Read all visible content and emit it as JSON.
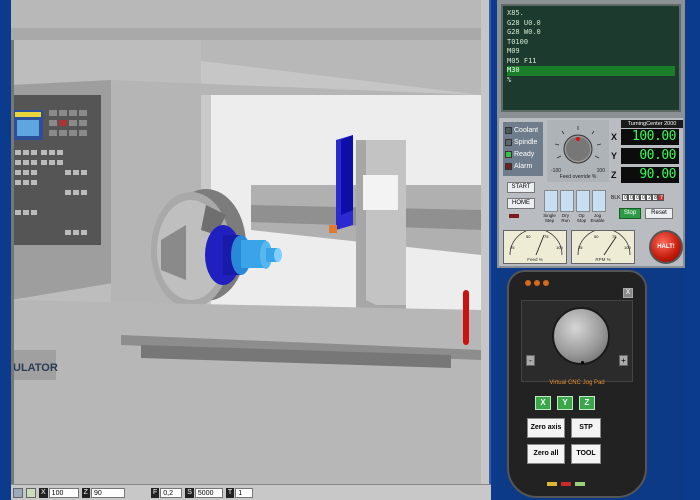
{
  "gcode": {
    "lines": [
      "X85.",
      "G28 U0.0",
      "G28 W0.0",
      "T0100",
      "M09",
      "M05 F11",
      "M30",
      "%"
    ],
    "active_index": 6
  },
  "status": {
    "items": [
      {
        "label": "Coolant",
        "color": "#4a5a5a"
      },
      {
        "label": "Spindle",
        "color": "#5a6a6a"
      },
      {
        "label": "Ready",
        "color": "#35c24a"
      },
      {
        "label": "Alarm",
        "color": "#6a2222"
      }
    ]
  },
  "feed": {
    "label": "Feed override %",
    "min": "-100",
    "max": "100"
  },
  "readouts": {
    "title": "TurningCenter 2000",
    "x": {
      "axis": "X",
      "value": "100.00"
    },
    "y": {
      "axis": "Y",
      "value": "00.00"
    },
    "z": {
      "axis": "Z",
      "value": "90.00"
    }
  },
  "buttons": {
    "start": "START",
    "home": "HOME",
    "stop": "Stop",
    "reset": "Reset",
    "halt": "HALT!"
  },
  "toggles": [
    "Single Step",
    "Dry Run",
    "Op Stop",
    "Jog Enable"
  ],
  "block": {
    "label": "BLK",
    "digits": [
      "0",
      "0",
      "0",
      "0",
      "2",
      "8",
      "7"
    ]
  },
  "gauges": {
    "feed_label": "Feed %",
    "rpm_label": "RPM %",
    "ticks": [
      "25",
      "50",
      "75",
      "100"
    ],
    "zero": "0"
  },
  "jog": {
    "title": "Virtual CNC Jog Pad",
    "close": "X",
    "minus": "-",
    "plus": "+",
    "axes": [
      "X",
      "Y",
      "Z"
    ],
    "zero_axis": "Zero axis",
    "stp": "STP",
    "zero_all": "Zero all",
    "tool": "TOOL"
  },
  "statusbar": {
    "x_key": "X",
    "x_val": "100",
    "z_key": "Z",
    "z_val": "90",
    "f_key": "F",
    "f_val": "0,2",
    "s_key": "S",
    "s_val": "5000",
    "t_key": "T",
    "t_val": "1"
  },
  "machine": {
    "logo_text": "ULATOR"
  },
  "colors": {
    "readout_green": "#33ff55",
    "active_line": "#1b7d2a",
    "halt_red": "#c21a0a",
    "jog_orange": "#e58a2a"
  }
}
